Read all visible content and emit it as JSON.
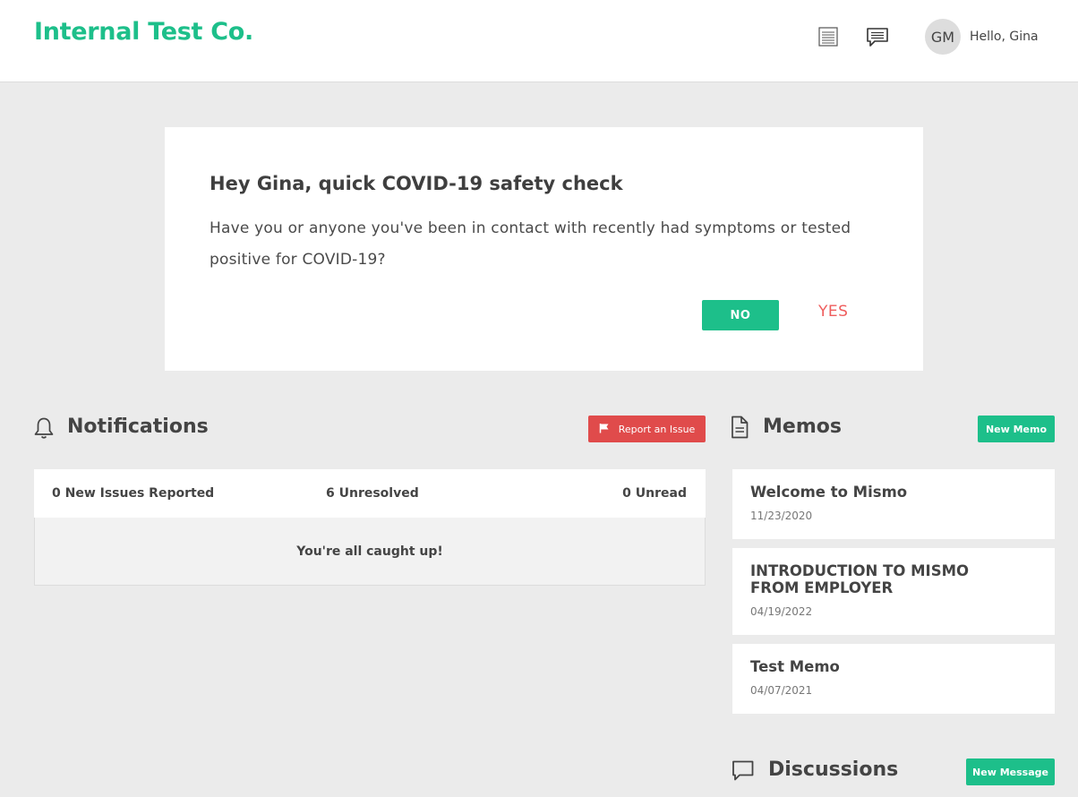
{
  "header": {
    "brand": "Internal Test Co.",
    "avatar_initials": "GM",
    "greeting": "Hello, Gina",
    "icons": [
      "memo-list-icon",
      "message-icon"
    ]
  },
  "safety_check": {
    "title": "Hey Gina, quick COVID-19 safety check",
    "question": "Have you or anyone you've been in contact with recently had symptoms or tested positive for COVID-19?",
    "no_label": "NO",
    "yes_label": "YES"
  },
  "notifications": {
    "title": "Notifications",
    "report_button": "Report an Issue",
    "stats": {
      "new_issues": "0 New Issues Reported",
      "unresolved": "6 Unresolved",
      "unread": "0 Unread"
    },
    "empty_message": "You're all caught up!"
  },
  "memos": {
    "title": "Memos",
    "new_button": "New Memo",
    "items": [
      {
        "title": "Welcome to Mismo",
        "date": "11/23/2020"
      },
      {
        "title": "INTRODUCTION TO MISMO FROM EMPLOYER",
        "date": "04/19/2022"
      },
      {
        "title": "Test Memo",
        "date": "04/07/2021"
      }
    ]
  },
  "discussions": {
    "title": "Discussions",
    "new_button": "New Message"
  },
  "colors": {
    "brand": "#1dbf8a",
    "danger": "#e04b4b",
    "yes_text": "#ef5d5d",
    "background": "#ebebeb"
  }
}
